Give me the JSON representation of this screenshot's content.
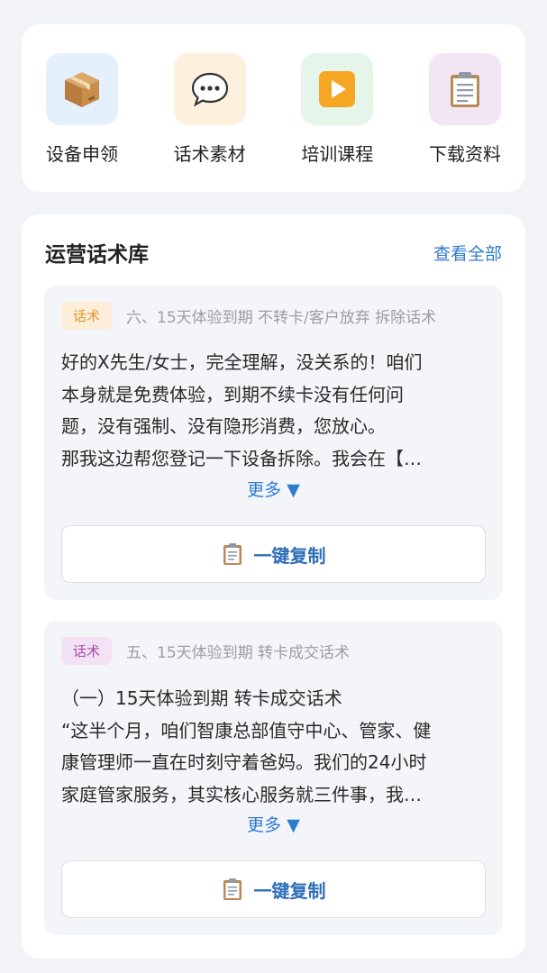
{
  "quick_actions": [
    {
      "label": "设备申领",
      "icon": "package-icon",
      "bg": "#e4f0fc"
    },
    {
      "label": "话术素材",
      "icon": "speech-bubble-icon",
      "bg": "#fdf0dd"
    },
    {
      "label": "培训课程",
      "icon": "play-button-icon",
      "bg": "#e6f5ea"
    },
    {
      "label": "下载资料",
      "icon": "clipboard-icon",
      "bg": "#f3e6f4"
    }
  ],
  "library": {
    "title": "运营话术库",
    "view_all": "查看全部",
    "items": [
      {
        "tag": "话术",
        "title": "六、15天体验到期 不转卡/客户放弃 拆除话术",
        "body": "好的X先生/女士，完全理解，没关系的！咱们\n本身就是免费体验，到期不续卡没有任何问\n题，没有强制、没有隐形消费，您放心。\n那我这边帮您登记一下设备拆除。我会在【…",
        "more": "更多 ▼",
        "copy": "一键复制"
      },
      {
        "tag": "话术",
        "title": "五、15天体验到期 转卡成交话术",
        "body": "（一）15天体验到期 转卡成交话术\n“这半个月，咱们智康总部值守中心、管家、健\n康管理师一直在时刻守着爸妈。我们的24小时\n家庭管家服务，其实核心服务就三件事，我…",
        "more": "更多 ▼",
        "copy": "一键复制"
      }
    ]
  },
  "colors": {
    "accent": "#2f7bd0",
    "tag_orange": "#e69433",
    "tag_purple": "#a64aa8"
  }
}
